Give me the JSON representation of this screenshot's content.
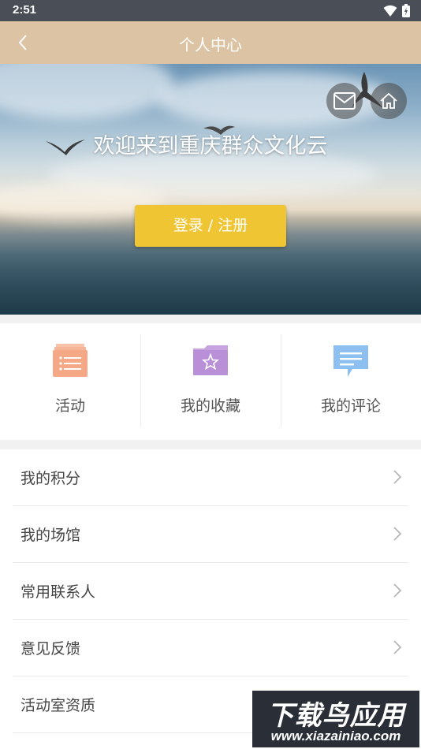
{
  "status_bar": {
    "time": "2:51"
  },
  "header": {
    "title": "个人中心"
  },
  "hero": {
    "welcome": "欢迎来到重庆群众文化云",
    "login_label": "登录 / 注册"
  },
  "quick_actions": [
    {
      "label": "活动",
      "icon": "activity-list-icon",
      "color": "#f5a885"
    },
    {
      "label": "我的收藏",
      "icon": "favorites-folder-icon",
      "color": "#c7a3e0"
    },
    {
      "label": "我的评论",
      "icon": "comment-bubble-icon",
      "color": "#8dc0f0"
    }
  ],
  "menu": [
    {
      "label": "我的积分"
    },
    {
      "label": "我的场馆"
    },
    {
      "label": "常用联系人"
    },
    {
      "label": "意见反馈"
    },
    {
      "label": "活动室资质"
    }
  ],
  "watermark": {
    "title": "下载鸟应用",
    "url": "www.xiazainiao.com"
  },
  "colors": {
    "header": "#dcc3a3",
    "login_button": "#f0c534"
  }
}
